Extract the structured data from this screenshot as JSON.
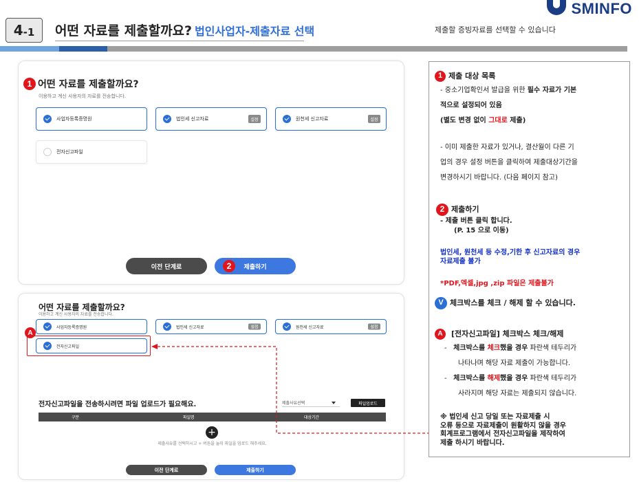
{
  "header": {
    "step_num": "4",
    "step_sub": "-1",
    "title": "어떤 자료를 제출할까요?",
    "subtitle": "법인사업자-제출자료 선택",
    "desc": "제출할 증빙자료를 선택할 수 있습니다",
    "logo_text": "SMINFO"
  },
  "panel1": {
    "marker": "1",
    "title": "어떤 자료를 제출할까요?",
    "subtitle": "이용하고 계신 사용자의 자료를 전송합니다.",
    "cards": [
      {
        "label": "사업자등록증명원",
        "checked": true,
        "set": ""
      },
      {
        "label": "법인세 신고자료",
        "checked": true,
        "set": "설정"
      },
      {
        "label": "원천세 신고자료",
        "checked": true,
        "set": "설정"
      },
      {
        "label": "전자신고파일",
        "checked": false,
        "set": ""
      }
    ],
    "prev_label": "이전 단계로",
    "submit_marker": "2",
    "submit_label": "제출하기"
  },
  "panel2": {
    "title": "어떤 자료를 제출할까요?",
    "subtitle": "이용하고 계신 사용자의 자료를 전송합니다.",
    "marker_a": "A",
    "cards": [
      {
        "label": "사업자등록증명원",
        "set": ""
      },
      {
        "label": "법인세 신고자료",
        "set": "설정"
      },
      {
        "label": "원천세 신고자료",
        "set": "설정"
      },
      {
        "label": "전자신고파일",
        "set": ""
      }
    ],
    "upload_title": "전자신고파일을 전송하시려면 파일 업로드가 필요해요.",
    "select_value": "제출사유선택",
    "upload_button": "파일업로드",
    "columns": [
      "구분",
      "파일명",
      "대상기간"
    ],
    "plus": "+",
    "hint": "제출사유를 선택하시고 + 버튼을 눌러 파일을 업로드 해주세요.",
    "prev_label": "이전 단계로",
    "submit_label": "제출하기"
  },
  "explain": {
    "s1_marker": "1",
    "s1_title": "제출 대상 목록",
    "s1_l1a": "- 중소기업확인서 발급을 위한 ",
    "s1_l1b": "필수 자료가 기본",
    "s1_l2": "적으로 설정되어 있음",
    "s1_l3a": "(별도 변경 없이 ",
    "s1_l3b": "그대로",
    "s1_l3c": " 제출)",
    "s1_l4": "- 이미 제출한 자료가 있거나, 결산월이 다른 기",
    "s1_l5": "업의 경우 설정 버튼을 클릭하여 제출대상기간을",
    "s1_l6": "변경하시기 바랍니다. (다음 페이지 참고)",
    "s2_marker": "2",
    "s2_title": "제출하기",
    "s2_l1": "-   제출 버튼 클릭 합니다.",
    "s2_l2": "(P. 15 으로 이동)",
    "s2_blue1": "법인세, 원천세 등 수정,기한 후 신고자료의 경우",
    "s2_blue2": "자료제출 불가",
    "s2_red": "*PDF,엑셀,jpg ,zip 파일은 제출불가",
    "v_marker": "V",
    "v_text": "체크박스를 체크 / 해제 할 수 있습니다.",
    "a_marker": "A",
    "a_title": "[전자신고파일] 체크박스 체크/해제",
    "a1a": "체크박스를 ",
    "a1b": "체크",
    "a1c": "했을 경우",
    "a1d": " 파란색 테두리가",
    "a1e": "나타나며 해당 자료 제출이 가능합니다.",
    "a2a": "체크박스를 ",
    "a2b": "해제",
    "a2c": "했을 경우",
    "a2d": " 파란색 테두리가",
    "a2e": "사라지며 해당 자료는 제출되지 않습니다.",
    "note1": "※  법인세 신고 당일 또는 자료제출 시",
    "note2": "오류 등으로 자료제출이 원활하지 않을 경우",
    "note3": "회계프로그램에서 전자신고파일을 제작하여",
    "note4": "제출 하시기 바랍니다."
  }
}
